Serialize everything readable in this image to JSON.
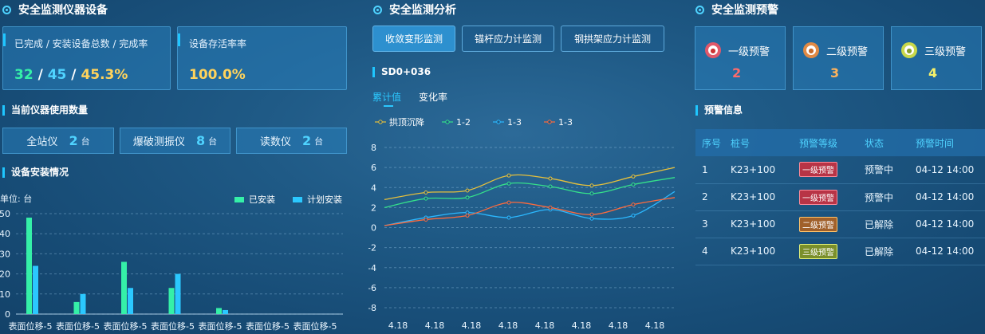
{
  "left": {
    "title": "安全监测仪器设备",
    "completion_card": {
      "label": "已完成 / 安装设备总数 / 完成率",
      "completed": "32",
      "sep1": " / ",
      "total": "45",
      "sep2": " / ",
      "rate": "45.3%"
    },
    "survival_card": {
      "label": "设备存活率率",
      "value": "100.0%"
    },
    "usage_title": "当前仪器使用数量",
    "instruments": [
      {
        "name": "全站仪",
        "count": "2",
        "unit": "台"
      },
      {
        "name": "爆破测振仪",
        "count": "8",
        "unit": "台"
      },
      {
        "name": "读数仪",
        "count": "2",
        "unit": "台"
      }
    ],
    "install_title": "设备安装情况"
  },
  "middle": {
    "title": "安全监测分析",
    "tabs": [
      {
        "label": "收敛变形监测",
        "active": true
      },
      {
        "label": "锚杆应力计监测",
        "active": false
      },
      {
        "label": "钢拱架应力计监测",
        "active": false
      }
    ],
    "section_label": "SD0+036",
    "sub_tabs": [
      {
        "label": "累计值",
        "active": true
      },
      {
        "label": "变化率",
        "active": false
      }
    ]
  },
  "right": {
    "title": "安全监测预警",
    "levels": [
      {
        "label": "一级预警",
        "count": "2",
        "color": "#ff6b6b",
        "icon_bg": "#e0586a"
      },
      {
        "label": "二级预警",
        "count": "3",
        "color": "#ffb35c",
        "icon_bg": "#e08a45"
      },
      {
        "label": "三级预警",
        "count": "4",
        "color": "#f5f06a",
        "icon_bg": "#c8d84a"
      }
    ],
    "info_title": "预警信息",
    "table": {
      "headers": [
        "序号",
        "桩号",
        "预警等级",
        "状态",
        "预警时间"
      ],
      "rows": [
        [
          "1",
          "K23+100",
          "一级预警",
          "预警中",
          "04-12 14:00"
        ],
        [
          "2",
          "K23+100",
          "一级预警",
          "预警中",
          "04-12 14:00"
        ],
        [
          "3",
          "K23+100",
          "二级预警",
          "已解除",
          "04-12 14:00"
        ],
        [
          "4",
          "K23+100",
          "三级预警",
          "已解除",
          "04-12 14:00"
        ]
      ],
      "level_classes": [
        "lv1",
        "lv1",
        "lv2",
        "lv3"
      ]
    }
  },
  "chart_data": [
    {
      "type": "bar",
      "ylabel": "单位: 台",
      "categories": [
        "表面位移-5",
        "表面位移-5",
        "表面位移-5",
        "表面位移-5",
        "表面位移-5",
        "表面位移-5",
        "表面位移-5"
      ],
      "series": [
        {
          "name": "已安装",
          "color": "#35f0a8",
          "values": [
            48,
            6,
            26,
            13,
            3,
            0,
            0
          ]
        },
        {
          "name": "计划安装",
          "color": "#2bc8ff",
          "values": [
            24,
            10,
            13,
            20,
            2,
            0,
            0
          ]
        }
      ],
      "ylim": [
        0,
        50
      ],
      "yticks": [
        0,
        10,
        20,
        30,
        40,
        50
      ],
      "legend": "top-right",
      "grid": true
    },
    {
      "type": "line",
      "x": [
        "4.18",
        "4.18",
        "4.18",
        "4.18",
        "4.18",
        "4.18",
        "4.18",
        "4.18"
      ],
      "series": [
        {
          "name": "拱顶沉降",
          "color": "#e6c03c",
          "values": [
            2.8,
            3.5,
            3.7,
            5.2,
            4.9,
            4.2,
            5.1,
            6.0
          ]
        },
        {
          "name": "1-2",
          "color": "#35e08a",
          "values": [
            2.0,
            2.9,
            3.0,
            4.4,
            4.1,
            3.4,
            4.3,
            5.0
          ]
        },
        {
          "name": "1-3",
          "color": "#2bb8ff",
          "values": [
            0.2,
            1.0,
            1.5,
            1.0,
            1.8,
            0.9,
            1.2,
            3.6
          ]
        },
        {
          "name": "1-3",
          "color": "#ff6a3c",
          "values": [
            0.2,
            0.8,
            1.2,
            2.5,
            2.0,
            1.3,
            2.3,
            3.0
          ]
        }
      ],
      "ylim": [
        -8,
        8
      ],
      "yticks": [
        -8,
        -6,
        -4,
        -2,
        0,
        2,
        4,
        6,
        8
      ],
      "legend": "top-left",
      "grid": true
    }
  ]
}
